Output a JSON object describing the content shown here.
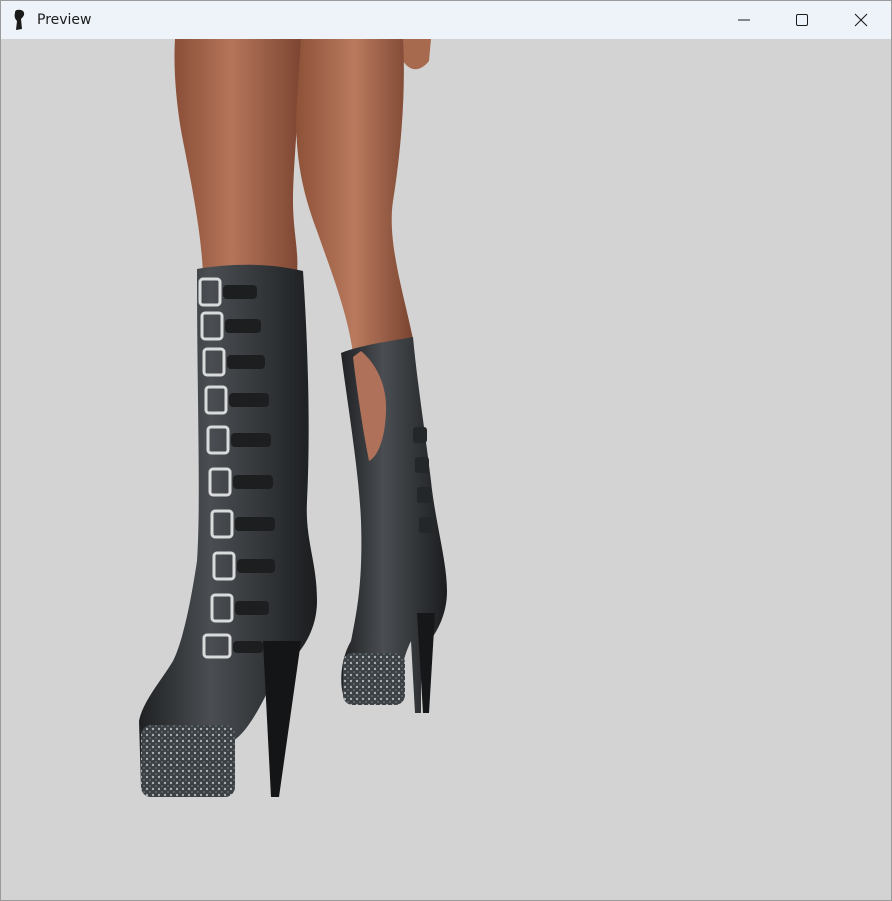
{
  "window": {
    "title": "Preview",
    "icons": {
      "app": "figure-silhouette-icon",
      "minimize": "minimize-icon",
      "maximize": "maximize-icon",
      "close": "close-icon"
    }
  },
  "viewport": {
    "background": "#d3d3d3",
    "content": "3d-model-render"
  },
  "colors": {
    "titlebar": "#eef3f9",
    "skin": "#a8684e",
    "boot": "#2b2d2f",
    "buckle": "#d8d8d8"
  }
}
